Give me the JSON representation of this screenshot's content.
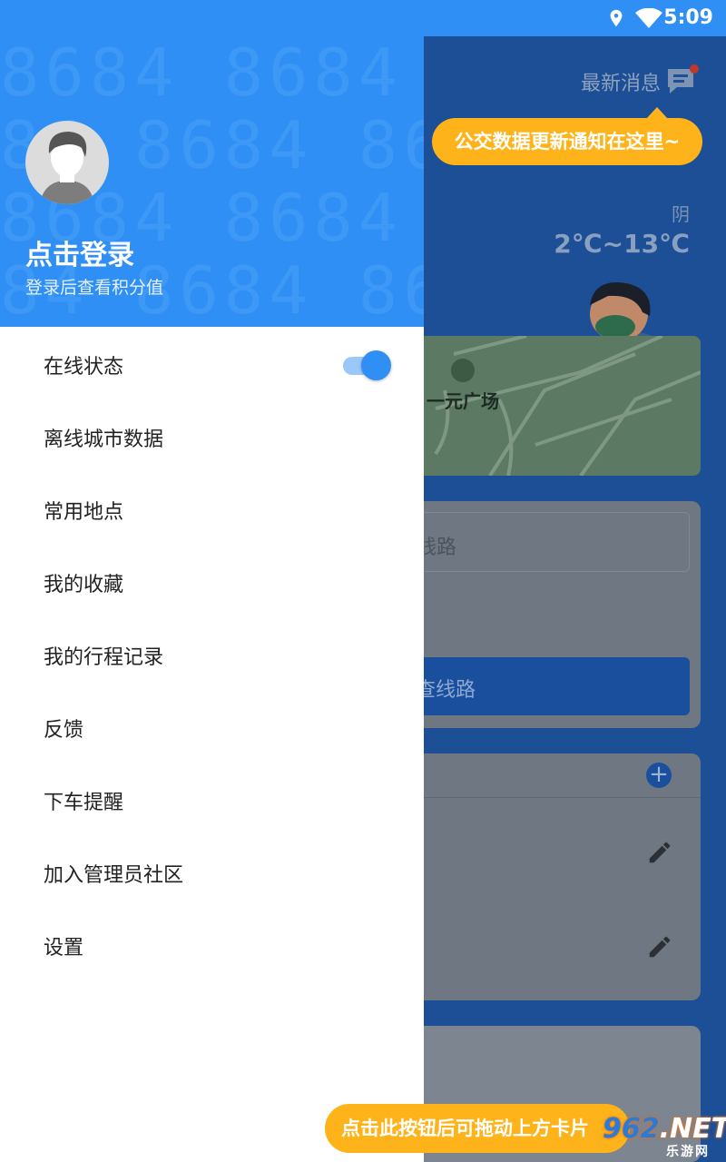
{
  "status_bar": {
    "time": "5:09"
  },
  "background": {
    "news_label": "最新消息",
    "tooltip_top": "公交数据更新通知在这里~",
    "weather": "阴",
    "temperature": "2℃~13℃",
    "map_label": "一元广场",
    "search_placeholder_partial": "线路",
    "search_button_partial": "查线路",
    "tooltip_bottom": "点击此按钮后可拖动上方卡片",
    "watermark_number": "962",
    "watermark_suffix": ".NET",
    "watermark_sub": "乐游网"
  },
  "drawer": {
    "header_pattern": [
      "8684 8684 8684",
      "84 8684 8684 86",
      "8684 8684 8684",
      "84 8684 8684 86"
    ],
    "login_title": "点击登录",
    "login_subtitle": "登录后查看积分值",
    "online_toggle_on": true,
    "menu": [
      {
        "label": "在线状态"
      },
      {
        "label": "离线城市数据"
      },
      {
        "label": "常用地点"
      },
      {
        "label": "我的收藏"
      },
      {
        "label": "我的行程记录"
      },
      {
        "label": "反馈"
      },
      {
        "label": "下车提醒"
      },
      {
        "label": "加入管理员社区"
      },
      {
        "label": "设置"
      }
    ]
  },
  "colors": {
    "primary": "#2f8ff5",
    "accent": "#ffb31a"
  }
}
